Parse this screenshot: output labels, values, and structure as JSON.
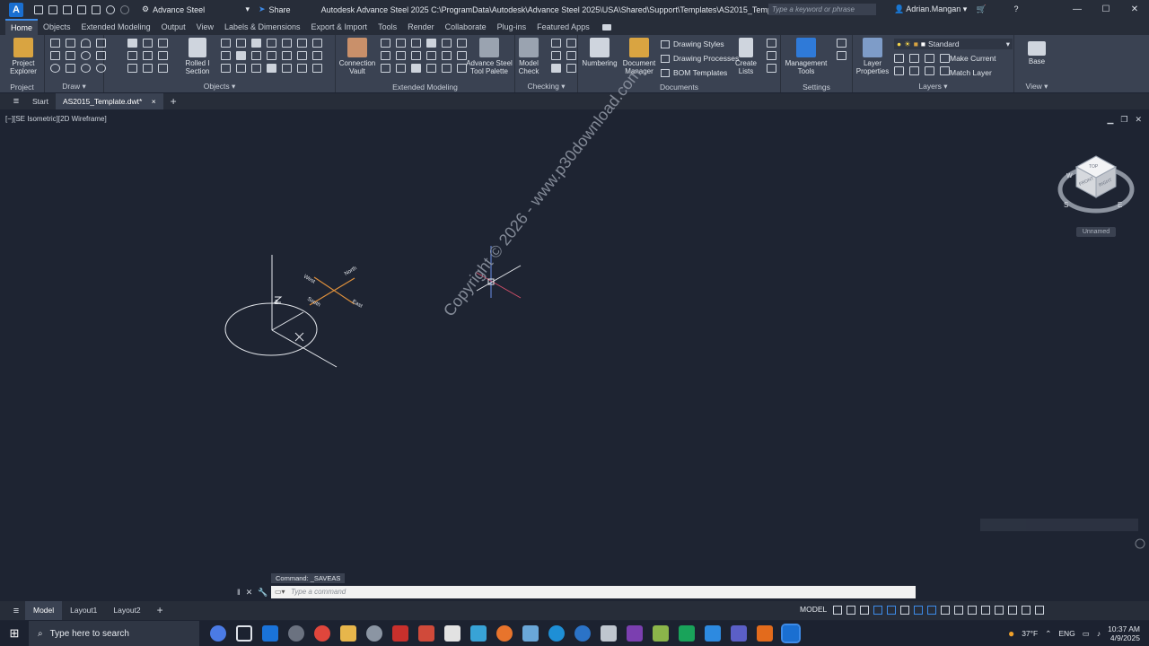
{
  "titlebar": {
    "app_letter": "A",
    "workspace": "Advance Steel",
    "share": "Share",
    "title": "Autodesk Advance Steel 2025    C:\\ProgramData\\Autodesk\\Advance Steel 2025\\USA\\Shared\\Support\\Templates\\AS2015_Template.dwt",
    "search_placeholder": "Type a keyword or phrase",
    "user": "Adrian.Mangan",
    "minimize": "—",
    "maximize": "☐",
    "close": "✕"
  },
  "ribbon_tabs": [
    "Home",
    "Objects",
    "Extended Modeling",
    "Output",
    "View",
    "Labels & Dimensions",
    "Export & Import",
    "Tools",
    "Render",
    "Collaborate",
    "Plug-ins",
    "Featured Apps"
  ],
  "ribbon": {
    "project_explorer": "Project Explorer",
    "rolled_section": "Rolled I Section",
    "connection_vault": "Connection Vault",
    "tool_palette": "Advance Steel Tool Palette",
    "model_check": "Model Check",
    "numbering": "Numbering",
    "document_manager": "Document Manager",
    "drawing_styles": "Drawing Styles",
    "drawing_processes": "Drawing Processes",
    "bom_templates": "BOM Templates",
    "create_lists": "Create Lists",
    "management_tools": "Management Tools",
    "layer_properties": "Layer Properties",
    "layer_name": "Standard",
    "make_current": "Make Current",
    "match_layer": "Match Layer",
    "base": "Base",
    "panels": {
      "project": "Project",
      "draw": "Draw ▾",
      "objects": "Objects ▾",
      "extended_modeling": "Extended Modeling",
      "checking": "Checking ▾",
      "documents": "Documents",
      "settings": "Settings",
      "layers": "Layers ▾",
      "view": "View ▾"
    }
  },
  "file_tabs": {
    "start": "Start",
    "active": "AS2015_Template.dwt*",
    "close": "×",
    "add": "+"
  },
  "viewport": {
    "label": "[−][SE Isometric][2D Wireframe]",
    "viewcube_face_top": "TOP",
    "viewcube_face_front": "FRONT",
    "viewcube_face_right": "RIGHT",
    "compass_s": "S",
    "compass_w": "W",
    "compass_e": "E",
    "ucs_name": "Unnamed",
    "compass_west": "West",
    "compass_north": "North",
    "compass_south": "South",
    "compass_east": "East",
    "axis_z": "Z",
    "watermark": "Copyright © 2026 - www.p30download.com"
  },
  "command": {
    "history": "Command: _SAVEAS",
    "placeholder": "Type a command"
  },
  "status": {
    "tabs": [
      "Model",
      "Layout1",
      "Layout2"
    ],
    "add": "+",
    "model": "MODEL"
  },
  "taskbar": {
    "search": "Type here to search",
    "weather": "37°F",
    "lang": "ENG",
    "time": "10:37 AM",
    "date": "4/9/2025"
  },
  "colors": {
    "accent": "#3d8be8",
    "background": "#1e2432",
    "ribbon": "#3a4252"
  }
}
